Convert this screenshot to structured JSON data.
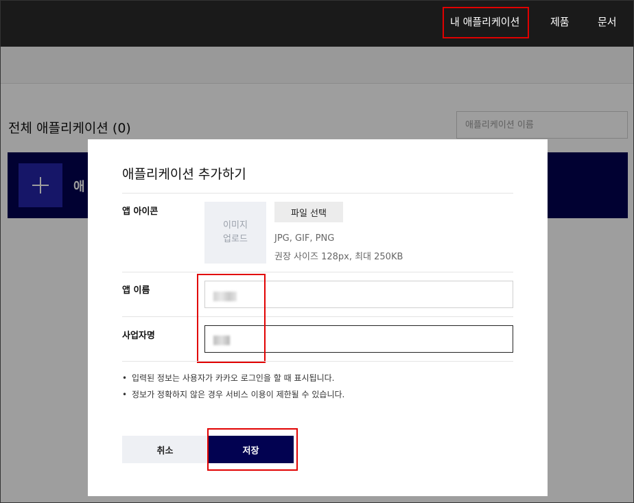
{
  "nav": {
    "items": [
      {
        "label": "내 애플리케이션",
        "highlighted": true
      },
      {
        "label": "제품"
      },
      {
        "label": "문서"
      }
    ]
  },
  "page": {
    "title": "전체 애플리케이션 (0)",
    "search_placeholder": "애플리케이션 이름",
    "add_banner_label": "애"
  },
  "modal": {
    "title": "애플리케이션 추가하기",
    "app_icon": {
      "label": "앱 아이콘",
      "upload_line1": "이미지",
      "upload_line2": "업로드",
      "file_button": "파일 선택",
      "hint_formats": "JPG, GIF, PNG",
      "hint_size": "권장 사이즈 128px, 최대 250KB"
    },
    "app_name": {
      "label": "앱 이름"
    },
    "company_name": {
      "label": "사업자명"
    },
    "notes": [
      "입력된 정보는 사용자가 카카오 로그인을 할 때 표시됩니다.",
      "정보가 정확하지 않은 경우 서비스 이용이 제한될 수 있습니다."
    ],
    "cancel_button": "취소",
    "save_button": "저장"
  },
  "colors": {
    "nav_bg": "#1a1a1a",
    "primary": "#020251",
    "highlight": "#e10000"
  }
}
